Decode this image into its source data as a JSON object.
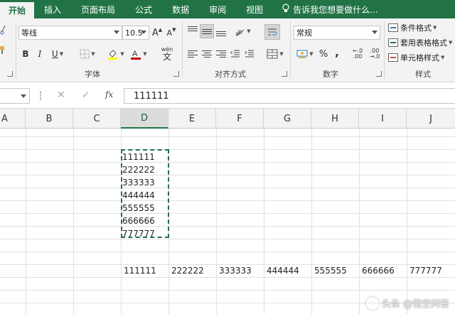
{
  "tabs": [
    {
      "label": "开始",
      "active": true
    },
    {
      "label": "插入"
    },
    {
      "label": "页面布局"
    },
    {
      "label": "公式"
    },
    {
      "label": "数据"
    },
    {
      "label": "审阅"
    },
    {
      "label": "视图"
    }
  ],
  "tell_me": "告诉我您想要做什么...",
  "font": {
    "name": "等线",
    "size": "10.5",
    "grow": "A",
    "shrink": "A",
    "bold": "B",
    "italic": "I",
    "underline": "U",
    "wen": "wén",
    "group_label": "字体"
  },
  "alignment": {
    "group_label": "对齐方式"
  },
  "number": {
    "format": "常规",
    "percent": "%",
    "comma": ",",
    "inc_decimal": "←.0 .00",
    "dec_decimal": ".00 →.0",
    "group_label": "数字"
  },
  "styles": {
    "conditional": "条件格式",
    "table": "套用表格格式",
    "cell": "单元格样式",
    "group_label": "样式"
  },
  "formula_bar": {
    "value": "111111",
    "fx": "fx"
  },
  "columns": [
    "A",
    "B",
    "C",
    "D",
    "E",
    "F",
    "G",
    "H",
    "I",
    "J"
  ],
  "selected_column": "D",
  "column_d_values": [
    "111111",
    "222222",
    "333333",
    "444444",
    "555555",
    "666666",
    "777777"
  ],
  "row_values": [
    "111111",
    "222222",
    "333333",
    "444444",
    "555555",
    "666666",
    "777777"
  ],
  "watermark": "头条 @悟空问答",
  "colors": {
    "accent": "#217346",
    "ribbon": "#f3f3f3",
    "font_color": "#c00000",
    "highlight": "#ffff00"
  }
}
